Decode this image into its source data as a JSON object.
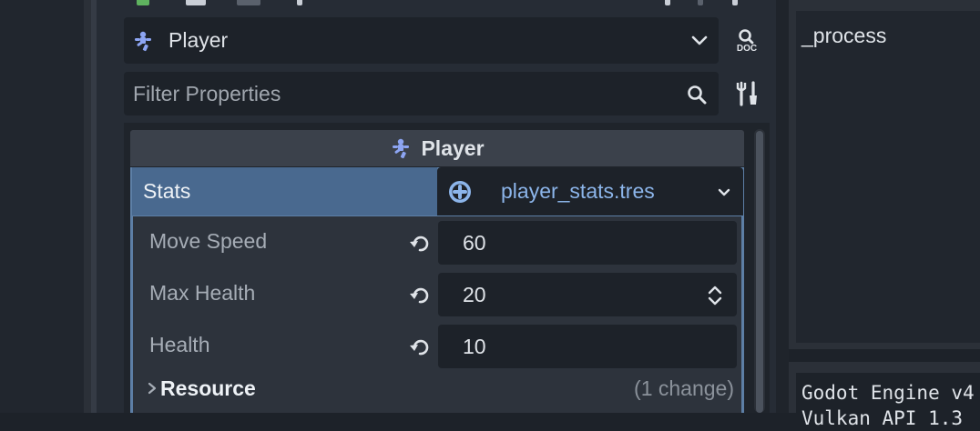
{
  "node_selector": {
    "icon": "player-node-icon",
    "label": "Player"
  },
  "doc_button": {
    "label": "DOC"
  },
  "filter": {
    "placeholder": "Filter Properties"
  },
  "category": {
    "title": "Player"
  },
  "stats": {
    "label": "Stats",
    "resource_name": "player_stats.tres",
    "properties": [
      {
        "label": "Move Speed",
        "value": "60"
      },
      {
        "label": "Max Health",
        "value": "20"
      },
      {
        "label": "Health",
        "value": "10"
      }
    ],
    "resource_section": {
      "title": "Resource",
      "changes": "(1 change)"
    }
  },
  "script_panel": {
    "method": "_process"
  },
  "output_panel": {
    "lines": "Godot Engine v4\nVulkan API 1.3"
  },
  "colors": {
    "accent": "#49698f",
    "resource_link": "#8cb5ea",
    "node_icon": "#8da5f3"
  }
}
